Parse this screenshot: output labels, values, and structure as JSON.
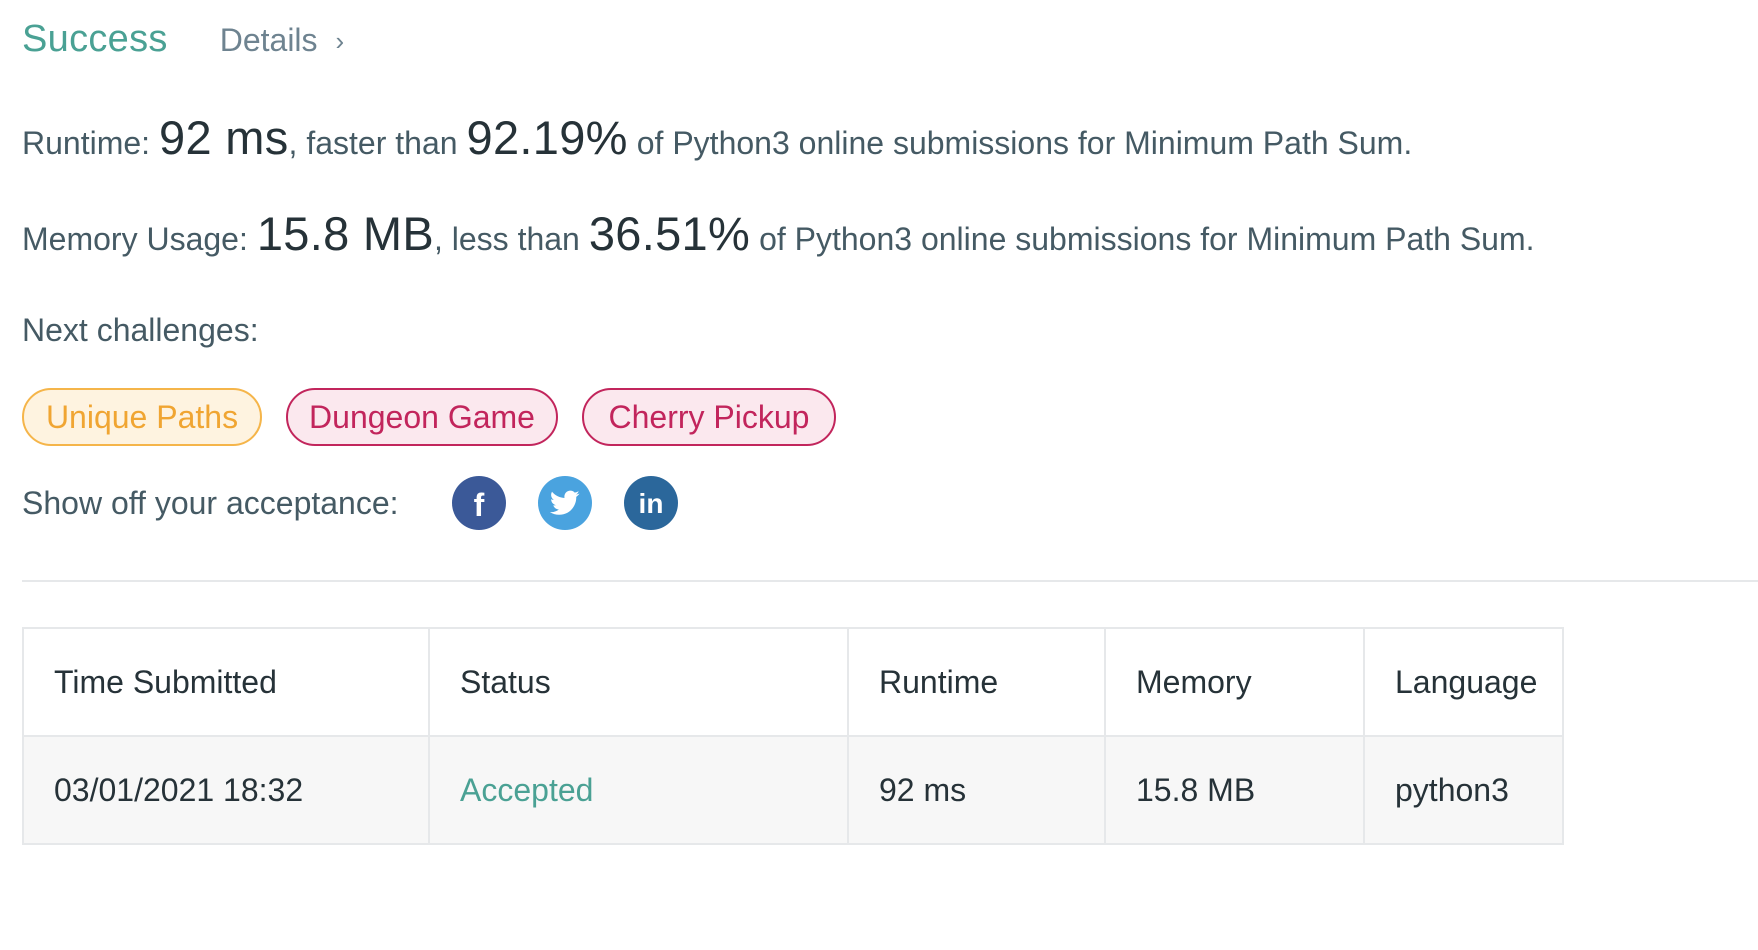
{
  "header": {
    "status": "Success",
    "details_label": "Details",
    "details_chevron": "›"
  },
  "runtime_stat": {
    "label": "Runtime:",
    "value": "92 ms",
    "comparison": ", faster than",
    "percentile": "92.19%",
    "suffix": "of Python3 online submissions for Minimum Path Sum."
  },
  "memory_stat": {
    "label": "Memory Usage:",
    "value": "15.8 MB",
    "comparison": ", less than",
    "percentile": "36.51%",
    "suffix": "of Python3 online submissions for Minimum Path Sum."
  },
  "next_challenges": {
    "label": "Next challenges:",
    "items": [
      {
        "title": "Unique Paths",
        "difficulty": "medium"
      },
      {
        "title": "Dungeon Game",
        "difficulty": "hard"
      },
      {
        "title": "Cherry Pickup",
        "difficulty": "hard"
      }
    ]
  },
  "share": {
    "label": "Show off your acceptance:",
    "icons": [
      "facebook-icon",
      "twitter-icon",
      "linkedin-icon"
    ],
    "facebook_glyph": "f",
    "linkedin_glyph": "in"
  },
  "submissions_table": {
    "columns": [
      "Time Submitted",
      "Status",
      "Runtime",
      "Memory",
      "Language"
    ],
    "rows": [
      {
        "time": "03/01/2021 18:32",
        "status": "Accepted",
        "runtime": "92 ms",
        "memory": "15.8 MB",
        "language": "python3"
      }
    ]
  },
  "colors": {
    "success_green": "#4aa194",
    "medium_orange": "#f0a532",
    "hard_crimson": "#c2255c",
    "facebook_blue": "#3b5998",
    "twitter_blue": "#4aa3df",
    "linkedin_blue": "#2b679b"
  }
}
